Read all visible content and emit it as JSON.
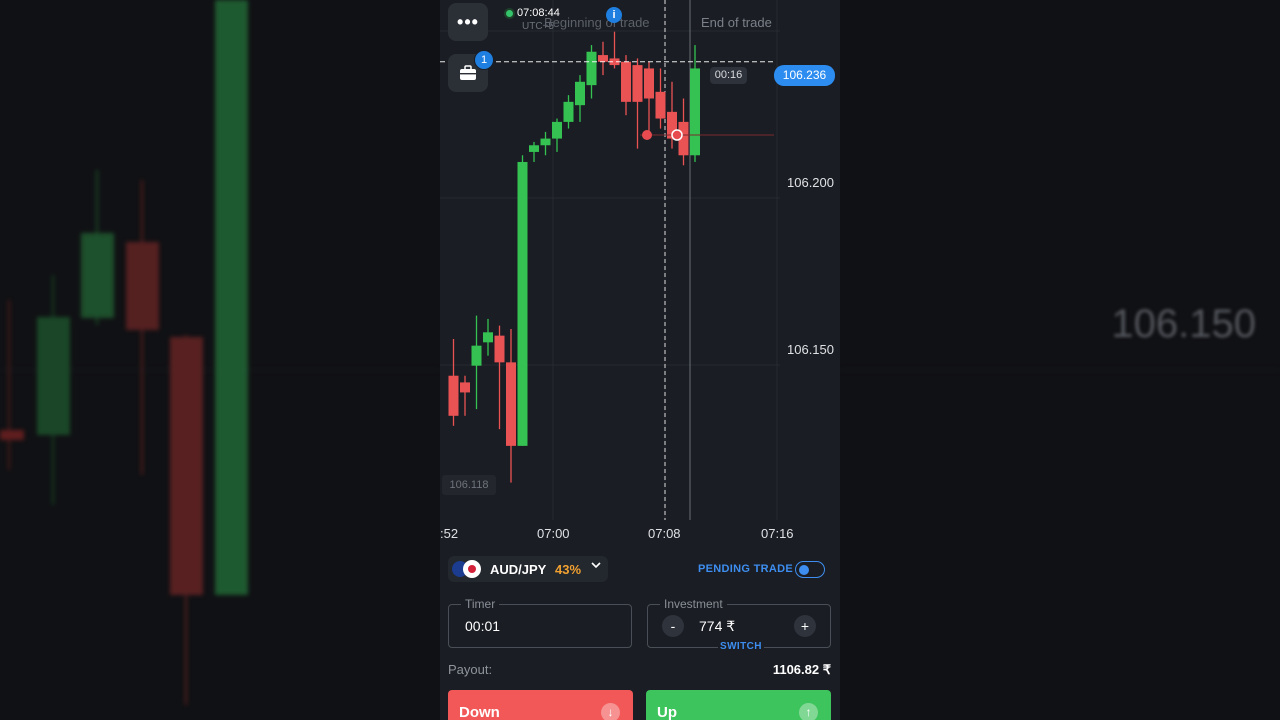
{
  "background": {
    "right_price": "106.150"
  },
  "top": {
    "menu_icon": "more-horizontal-icon",
    "clock": "07:08:44",
    "utc": "UTC+5",
    "beginning_label": "Beginning of trade",
    "end_label": "End of trade",
    "info_icon": "i",
    "portfolio_badge": "1"
  },
  "chart": {
    "current_price": "106.236",
    "countdown": "00:16",
    "low_label": "106.118",
    "y_ticks": [
      "106.200",
      "106.150"
    ],
    "x_ticks": [
      ":52",
      "07:00",
      "07:08",
      "07:16"
    ],
    "colors": {
      "up": "#35c252",
      "down": "#ea5354",
      "price_line": "#ffffff",
      "accent": "#2d8cf0"
    }
  },
  "chart_data": {
    "type": "candlestick",
    "series": [
      {
        "o": 106.142,
        "h": 106.153,
        "l": 106.127,
        "c": 106.13
      },
      {
        "o": 106.14,
        "h": 106.142,
        "l": 106.13,
        "c": 106.137
      },
      {
        "o": 106.145,
        "h": 106.16,
        "l": 106.132,
        "c": 106.151
      },
      {
        "o": 106.152,
        "h": 106.159,
        "l": 106.148,
        "c": 106.155
      },
      {
        "o": 106.154,
        "h": 106.157,
        "l": 106.126,
        "c": 106.146
      },
      {
        "o": 106.146,
        "h": 106.156,
        "l": 106.11,
        "c": 106.121
      },
      {
        "o": 106.121,
        "h": 106.208,
        "l": 106.121,
        "c": 106.206
      },
      {
        "o": 106.209,
        "h": 106.212,
        "l": 106.206,
        "c": 106.211
      },
      {
        "o": 106.211,
        "h": 106.215,
        "l": 106.208,
        "c": 106.213
      },
      {
        "o": 106.213,
        "h": 106.219,
        "l": 106.209,
        "c": 106.218
      },
      {
        "o": 106.218,
        "h": 106.226,
        "l": 106.216,
        "c": 106.224
      },
      {
        "o": 106.223,
        "h": 106.232,
        "l": 106.218,
        "c": 106.23
      },
      {
        "o": 106.229,
        "h": 106.241,
        "l": 106.225,
        "c": 106.239
      },
      {
        "o": 106.238,
        "h": 106.242,
        "l": 106.232,
        "c": 106.236
      },
      {
        "o": 106.237,
        "h": 106.245,
        "l": 106.234,
        "c": 106.235
      },
      {
        "o": 106.236,
        "h": 106.238,
        "l": 106.22,
        "c": 106.224
      },
      {
        "o": 106.235,
        "h": 106.237,
        "l": 106.21,
        "c": 106.224
      },
      {
        "o": 106.234,
        "h": 106.236,
        "l": 106.215,
        "c": 106.225
      },
      {
        "o": 106.227,
        "h": 106.234,
        "l": 106.216,
        "c": 106.219
      },
      {
        "o": 106.221,
        "h": 106.23,
        "l": 106.21,
        "c": 106.213
      },
      {
        "o": 106.218,
        "h": 106.225,
        "l": 106.205,
        "c": 106.208
      },
      {
        "o": 106.208,
        "h": 106.241,
        "l": 106.206,
        "c": 106.234
      }
    ],
    "current_price": 106.236,
    "ylim": [
      106.105,
      106.25
    ]
  },
  "panel": {
    "pair": "AUD/JPY",
    "payout_pct": "43%",
    "pending_label": "PENDING TRADE",
    "timer_label": "Timer",
    "timer_value": "00:01",
    "investment_label": "Investment",
    "investment_value": "774 ₹",
    "minus": "-",
    "plus": "+",
    "switch_label": "SWITCH",
    "payout_label": "Payout:",
    "payout_value": "1106.82 ₹",
    "down_label": "Down",
    "up_label": "Up"
  }
}
